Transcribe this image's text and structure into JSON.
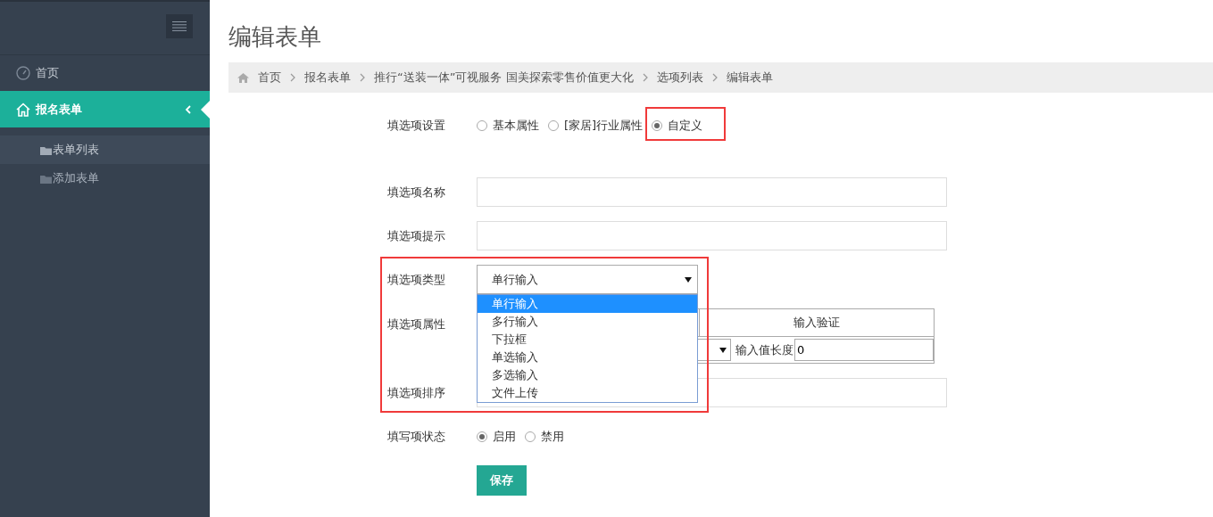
{
  "sidebar": {
    "items": [
      {
        "label": "首页",
        "selected": false
      },
      {
        "label": "报名表单",
        "selected": true,
        "expanded": true,
        "children": [
          {
            "label": "表单列表",
            "selected": true
          },
          {
            "label": "添加表单",
            "selected": false
          }
        ]
      }
    ]
  },
  "page_title": "编辑表单",
  "breadcrumb": [
    "首页",
    "报名表单",
    "推行“送装一体”可视服务 国美探索零售价值更大化",
    "选项列表",
    "编辑表单"
  ],
  "form": {
    "rows": [
      {
        "kind": "radio",
        "label": "填选项设置",
        "options": [
          {
            "label": "基本属性",
            "selected": false,
            "highlighted": false
          },
          {
            "label": "[家居]行业属性",
            "selected": false,
            "highlighted": false
          },
          {
            "label": "自定义",
            "selected": true,
            "highlighted": true
          }
        ]
      },
      {
        "kind": "text",
        "label": "填选项名称"
      },
      {
        "kind": "text",
        "label": "填选项提示"
      },
      {
        "kind": "select",
        "label": "填选项类型",
        "value": "单行输入",
        "expanded": true,
        "highlighted": true,
        "options": [
          {
            "label": "单行输入",
            "selected": true
          },
          {
            "label": "多行输入",
            "selected": false
          },
          {
            "label": "下拉框",
            "selected": false
          },
          {
            "label": "单选输入",
            "selected": false
          },
          {
            "label": "多选输入",
            "selected": false
          },
          {
            "label": "文件上传",
            "selected": false
          }
        ]
      },
      {
        "kind": "table",
        "label": "填选项属性",
        "header": "输入验证",
        "length_label": "输入值长度",
        "length_value": "0"
      },
      {
        "kind": "text",
        "label": "填选项排序"
      },
      {
        "kind": "radio",
        "label": "填写项状态",
        "options": [
          {
            "label": "启用",
            "selected": true,
            "highlighted": false
          },
          {
            "label": "禁用",
            "selected": false,
            "highlighted": false
          }
        ]
      }
    ],
    "submit": "保存"
  }
}
